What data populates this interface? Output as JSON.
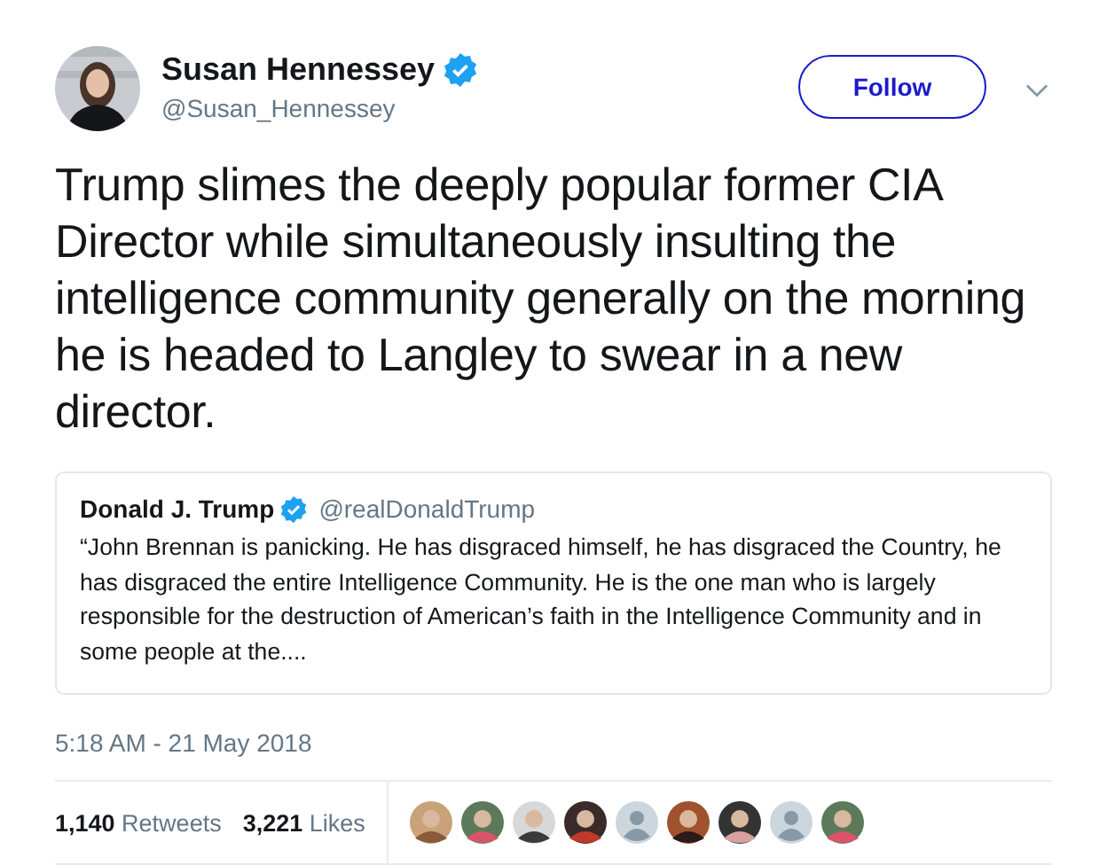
{
  "author": {
    "name": "Susan Hennessey",
    "handle": "@Susan_Hennessey",
    "verified": true
  },
  "follow_button": {
    "label": "Follow"
  },
  "text": "Trump slimes the deeply popular former CIA Director while simultaneously insulting the intelligence community generally on the morning he is headed to Langley to swear in a new director.",
  "quoted": {
    "name": "Donald J. Trump",
    "handle": "@realDonaldTrump",
    "verified": true,
    "text": "“John Brennan is panicking. He has disgraced himself, he has disgraced the Country, he has disgraced the entire Intelligence Community. He is the one man who is largely responsible for the destruction of American’s faith in the Intelligence Community and in some people at the...."
  },
  "timestamp": "5:18 AM - 21 May 2018",
  "stats": [
    {
      "count": "1,140",
      "label": "Retweets"
    },
    {
      "count": "3,221",
      "label": "Likes"
    }
  ],
  "likers": [
    {
      "kind": "picture"
    },
    {
      "kind": "picture"
    },
    {
      "kind": "picture"
    },
    {
      "kind": "picture"
    },
    {
      "kind": "default"
    },
    {
      "kind": "picture"
    },
    {
      "kind": "picture"
    },
    {
      "kind": "default"
    },
    {
      "kind": "picture"
    }
  ]
}
